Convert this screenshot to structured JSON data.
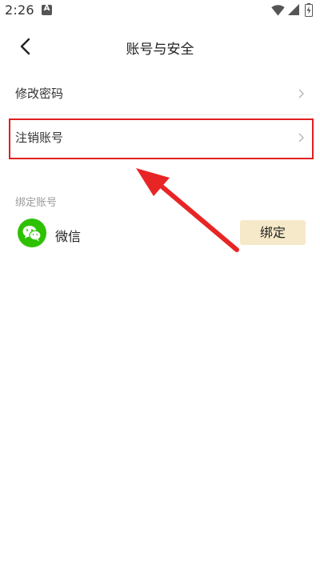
{
  "status_bar": {
    "time": "2:26",
    "icons": [
      "notification-a-icon",
      "wifi-icon",
      "signal-icon",
      "battery-icon"
    ]
  },
  "header": {
    "title": "账号与安全",
    "back_icon": "chevron-left-icon"
  },
  "menu": {
    "items": [
      {
        "label": "修改密码",
        "icon": "chevron-right-icon"
      },
      {
        "label": "注销账号",
        "icon": "chevron-right-icon",
        "highlighted": true
      }
    ]
  },
  "bind_section": {
    "title": "绑定账号",
    "accounts": [
      {
        "name": "微信",
        "icon": "wechat-icon",
        "button_label": "绑定"
      }
    ]
  },
  "colors": {
    "highlight": "#e02020",
    "wechat_green": "#2dc100",
    "bind_button_bg": "#f6e9c9"
  }
}
